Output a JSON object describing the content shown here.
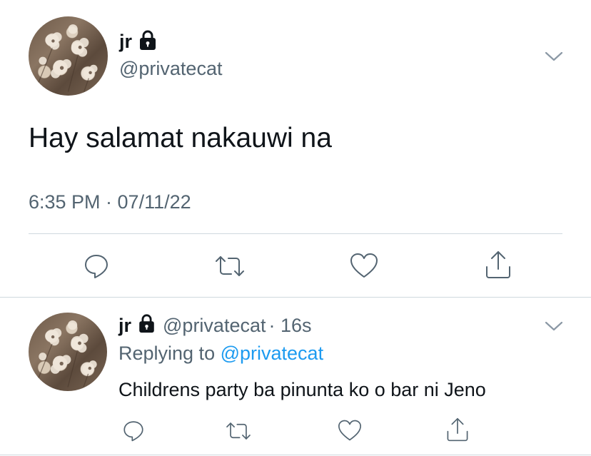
{
  "main_tweet": {
    "display_name": "jr",
    "handle": "@privatecat",
    "text": "Hay salamat nakauwi na",
    "timestamp": "6:35 PM · 07/11/22",
    "icons": {
      "lock": "lock-icon",
      "menu": "chevron-down-icon",
      "reply": "reply-icon",
      "retweet": "retweet-icon",
      "like": "heart-icon",
      "share": "share-icon"
    }
  },
  "reply_tweet": {
    "display_name": "jr",
    "handle": "@privatecat",
    "age": "· 16s",
    "replying_prefix": "Replying to",
    "replying_to": "@privatecat",
    "text": "Childrens party ba pinunta ko o bar ni Jeno"
  },
  "colors": {
    "text": "#0f1419",
    "muted": "#536471",
    "link": "#1d9bf0",
    "divider": "#cfd9de"
  }
}
